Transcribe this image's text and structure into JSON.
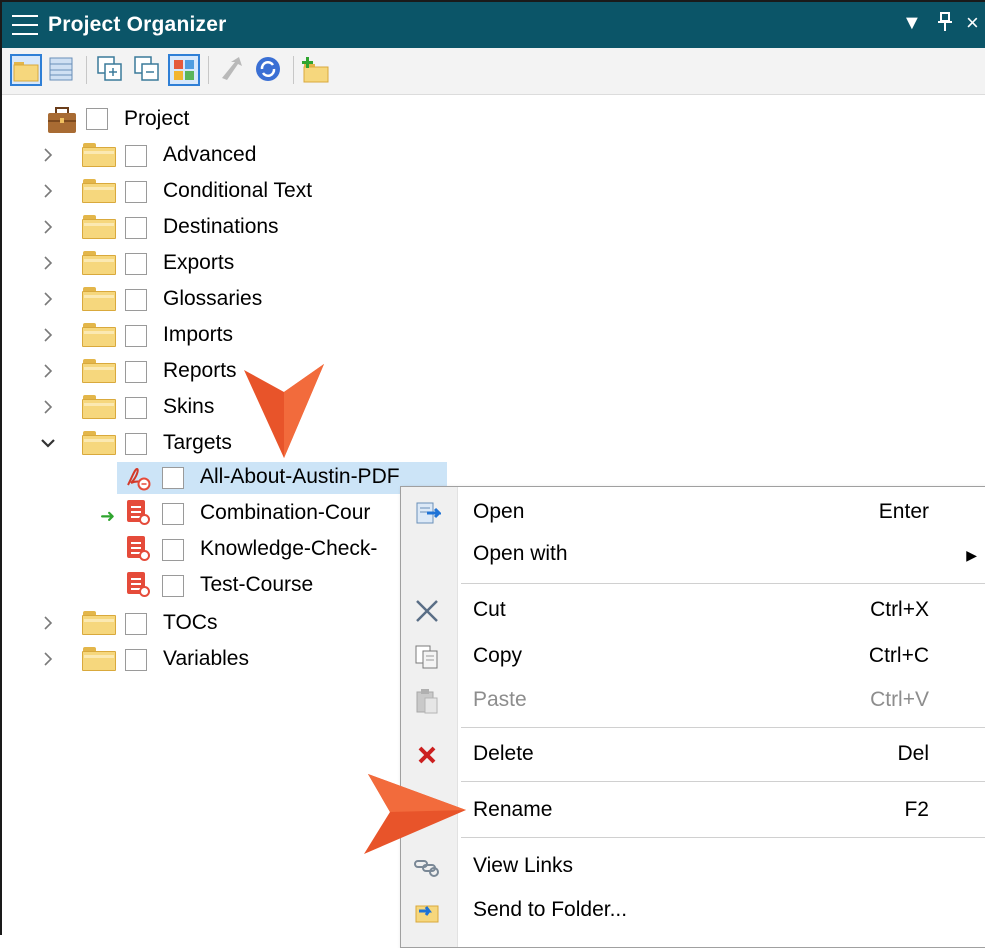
{
  "window": {
    "title": "Project Organizer",
    "controls": {
      "dropdown": "▼",
      "pin": "Ꮽ",
      "close": "×"
    }
  },
  "toolbar": {
    "buttons": [
      {
        "name": "folder-view",
        "active": true
      },
      {
        "name": "list-view",
        "active": false
      },
      {
        "name": "expand-all",
        "active": false
      },
      {
        "name": "collapse-all",
        "active": false
      },
      {
        "name": "show-icons",
        "active": true
      },
      {
        "name": "upload",
        "active": false,
        "disabled": true
      },
      {
        "name": "refresh",
        "active": false
      },
      {
        "name": "new-folder",
        "active": false
      }
    ]
  },
  "tree": {
    "root": "Project",
    "items": [
      {
        "label": "Advanced",
        "expanded": false
      },
      {
        "label": "Conditional Text",
        "expanded": false
      },
      {
        "label": "Destinations",
        "expanded": false
      },
      {
        "label": "Exports",
        "expanded": false
      },
      {
        "label": "Glossaries",
        "expanded": false
      },
      {
        "label": "Imports",
        "expanded": false
      },
      {
        "label": "Reports",
        "expanded": false
      },
      {
        "label": "Skins",
        "expanded": false
      },
      {
        "label": "Targets",
        "expanded": true
      }
    ],
    "targets": [
      {
        "label": "All-About-Austin-PDF",
        "selected": true,
        "type": "pdf"
      },
      {
        "label": "Combination-Cour",
        "primary": true,
        "type": "course"
      },
      {
        "label": "Knowledge-Check-",
        "type": "course"
      },
      {
        "label": "Test-Course",
        "type": "course"
      }
    ],
    "after": [
      {
        "label": "TOCs",
        "expanded": false
      },
      {
        "label": "Variables",
        "expanded": false
      }
    ]
  },
  "context_menu": {
    "items": [
      {
        "label": "Open",
        "shortcut": "Enter",
        "icon": "open-icon"
      },
      {
        "label": "Open with",
        "shortcut": "",
        "submenu": true
      },
      {
        "label": "Cut",
        "shortcut": "Ctrl+X",
        "icon": "scissors-icon"
      },
      {
        "label": "Copy",
        "shortcut": "Ctrl+C",
        "icon": "copy-icon"
      },
      {
        "label": "Paste",
        "shortcut": "Ctrl+V",
        "icon": "paste-icon",
        "disabled": true
      },
      {
        "label": "Delete",
        "shortcut": "Del",
        "icon": "delete-icon"
      },
      {
        "label": "Rename",
        "shortcut": "F2"
      },
      {
        "label": "View Links",
        "shortcut": "",
        "icon": "link-icon"
      },
      {
        "label": "Send to Folder...",
        "shortcut": "",
        "icon": "send-to-folder-icon"
      }
    ],
    "submenu_arrow": "▶"
  },
  "colors": {
    "titlebar": "#0b5568",
    "selection": "#cce4f7",
    "callout_arrow": "#e8542a",
    "primary_target_arrow": "#2fa52f",
    "delete_x": "#cc1f1f"
  }
}
